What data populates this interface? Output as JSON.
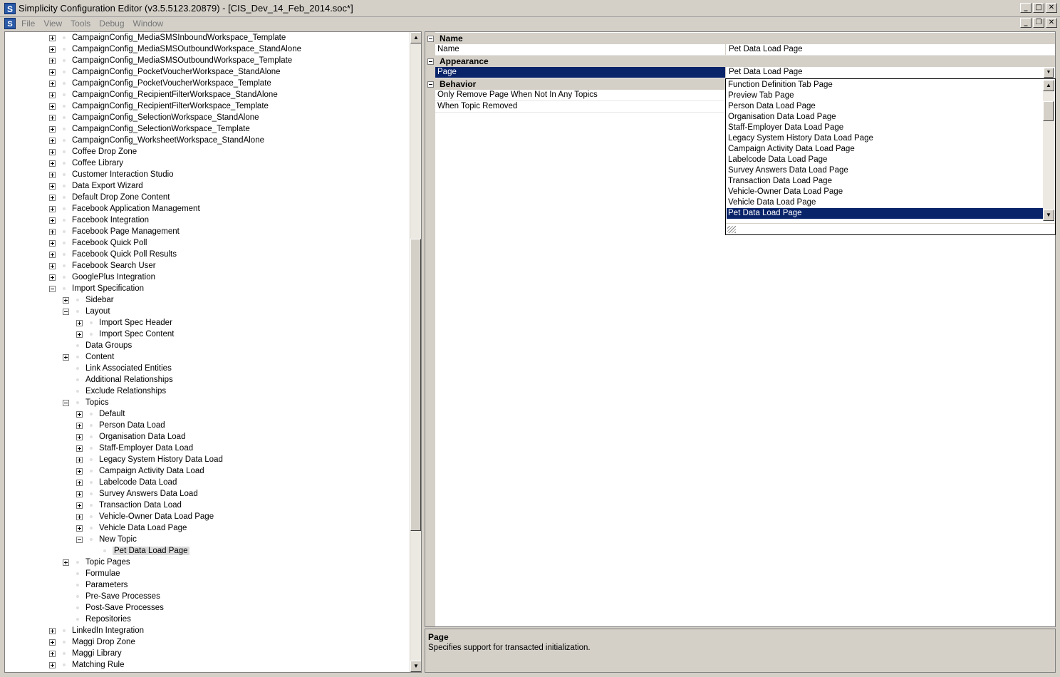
{
  "window": {
    "title": "Simplicity Configuration Editor (v3.5.5123.20879) - [CIS_Dev_14_Feb_2014.soc*]",
    "app_icon_letter": "S",
    "minimize": "_",
    "maximize": "□",
    "close": "✕",
    "restore": "❐"
  },
  "menu": {
    "items": [
      "File",
      "View",
      "Tools",
      "Debug",
      "Window"
    ]
  },
  "tree": {
    "rows": [
      {
        "label": "CampaignConfig_MediaSMSInboundWorkspace_Template",
        "level": 0,
        "exp": "plus"
      },
      {
        "label": "CampaignConfig_MediaSMSOutboundWorkspace_StandAlone",
        "level": 0,
        "exp": "plus"
      },
      {
        "label": "CampaignConfig_MediaSMSOutboundWorkspace_Template",
        "level": 0,
        "exp": "plus"
      },
      {
        "label": "CampaignConfig_PocketVoucherWorkspace_StandAlone",
        "level": 0,
        "exp": "plus"
      },
      {
        "label": "CampaignConfig_PocketVoucherWorkspace_Template",
        "level": 0,
        "exp": "plus"
      },
      {
        "label": "CampaignConfig_RecipientFilterWorkspace_StandAlone",
        "level": 0,
        "exp": "plus"
      },
      {
        "label": "CampaignConfig_RecipientFilterWorkspace_Template",
        "level": 0,
        "exp": "plus"
      },
      {
        "label": "CampaignConfig_SelectionWorkspace_StandAlone",
        "level": 0,
        "exp": "plus"
      },
      {
        "label": "CampaignConfig_SelectionWorkspace_Template",
        "level": 0,
        "exp": "plus"
      },
      {
        "label": "CampaignConfig_WorksheetWorkspace_StandAlone",
        "level": 0,
        "exp": "plus"
      },
      {
        "label": "Coffee Drop Zone",
        "level": 0,
        "exp": "plus"
      },
      {
        "label": "Coffee Library",
        "level": 0,
        "exp": "plus"
      },
      {
        "label": "Customer Interaction Studio",
        "level": 0,
        "exp": "plus"
      },
      {
        "label": "Data Export Wizard",
        "level": 0,
        "exp": "plus"
      },
      {
        "label": "Default Drop Zone Content",
        "level": 0,
        "exp": "plus"
      },
      {
        "label": "Facebook Application Management",
        "level": 0,
        "exp": "plus"
      },
      {
        "label": "Facebook Integration",
        "level": 0,
        "exp": "plus"
      },
      {
        "label": "Facebook Page Management",
        "level": 0,
        "exp": "plus"
      },
      {
        "label": "Facebook Quick Poll",
        "level": 0,
        "exp": "plus"
      },
      {
        "label": "Facebook Quick Poll Results",
        "level": 0,
        "exp": "plus"
      },
      {
        "label": "Facebook Search User",
        "level": 0,
        "exp": "plus"
      },
      {
        "label": "GooglePlus Integration",
        "level": 0,
        "exp": "plus"
      },
      {
        "label": "Import Specification",
        "level": 0,
        "exp": "minus"
      },
      {
        "label": "Sidebar",
        "level": 1,
        "exp": "plus"
      },
      {
        "label": "Layout",
        "level": 1,
        "exp": "minus"
      },
      {
        "label": "Import Spec Header",
        "level": 2,
        "exp": "plus"
      },
      {
        "label": "Import Spec Content",
        "level": 2,
        "exp": "plus"
      },
      {
        "label": "Data Groups",
        "level": 1,
        "exp": "none"
      },
      {
        "label": "Content",
        "level": 1,
        "exp": "plus"
      },
      {
        "label": "Link Associated Entities",
        "level": 1,
        "exp": "none"
      },
      {
        "label": "Additional Relationships",
        "level": 1,
        "exp": "none"
      },
      {
        "label": "Exclude Relationships",
        "level": 1,
        "exp": "none"
      },
      {
        "label": "Topics",
        "level": 1,
        "exp": "minus"
      },
      {
        "label": "Default",
        "level": 2,
        "exp": "plus"
      },
      {
        "label": "Person Data Load",
        "level": 2,
        "exp": "plus"
      },
      {
        "label": "Organisation Data Load",
        "level": 2,
        "exp": "plus"
      },
      {
        "label": "Staff-Employer Data Load",
        "level": 2,
        "exp": "plus"
      },
      {
        "label": "Legacy System History Data Load",
        "level": 2,
        "exp": "plus"
      },
      {
        "label": "Campaign Activity Data Load",
        "level": 2,
        "exp": "plus"
      },
      {
        "label": "Labelcode Data Load",
        "level": 2,
        "exp": "plus"
      },
      {
        "label": "Survey Answers Data Load",
        "level": 2,
        "exp": "plus"
      },
      {
        "label": "Transaction Data Load",
        "level": 2,
        "exp": "plus"
      },
      {
        "label": "Vehicle-Owner Data Load Page",
        "level": 2,
        "exp": "plus"
      },
      {
        "label": "Vehicle Data Load Page",
        "level": 2,
        "exp": "plus"
      },
      {
        "label": "New Topic",
        "level": 2,
        "exp": "minus"
      },
      {
        "label": "Pet Data Load Page",
        "level": 3,
        "exp": "none",
        "selected": true
      },
      {
        "label": "Topic Pages",
        "level": 1,
        "exp": "plus"
      },
      {
        "label": "Formulae",
        "level": 1,
        "exp": "none"
      },
      {
        "label": "Parameters",
        "level": 1,
        "exp": "none"
      },
      {
        "label": "Pre-Save Processes",
        "level": 1,
        "exp": "none"
      },
      {
        "label": "Post-Save Processes",
        "level": 1,
        "exp": "none"
      },
      {
        "label": "Repositories",
        "level": 1,
        "exp": "none"
      },
      {
        "label": "LinkedIn Integration",
        "level": 0,
        "exp": "plus"
      },
      {
        "label": "Maggi Drop Zone",
        "level": 0,
        "exp": "plus"
      },
      {
        "label": "Maggi Library",
        "level": 0,
        "exp": "plus"
      },
      {
        "label": "Matching Rule",
        "level": 0,
        "exp": "plus"
      }
    ]
  },
  "properties": {
    "categories": [
      {
        "label": "Name"
      },
      {
        "label": "Appearance"
      },
      {
        "label": "Behavior"
      }
    ],
    "rows": [
      {
        "name": "Name",
        "value": "Pet Data Load Page"
      },
      {
        "name": "Page",
        "value": "Pet Data Load Page"
      },
      {
        "name": "Only Remove Page When Not In Any Topics",
        "value": ""
      },
      {
        "name": "When Topic Removed",
        "value": ""
      }
    ]
  },
  "dropdown": {
    "items": [
      "Function Definition Tab Page",
      "Preview Tab Page",
      "Person Data Load Page",
      "Organisation Data Load Page",
      "Staff-Employer Data Load Page",
      "Legacy System History Data Load Page",
      "Campaign Activity Data Load Page",
      "Labelcode Data Load Page",
      "Survey Answers Data Load Page",
      "Transaction Data Load Page",
      "Vehicle-Owner Data Load Page",
      "Vehicle Data Load Page",
      "Pet Data Load Page"
    ],
    "selected": "Pet Data Load Page"
  },
  "description": {
    "title": "Page",
    "text": "Specifies support for transacted initialization."
  }
}
